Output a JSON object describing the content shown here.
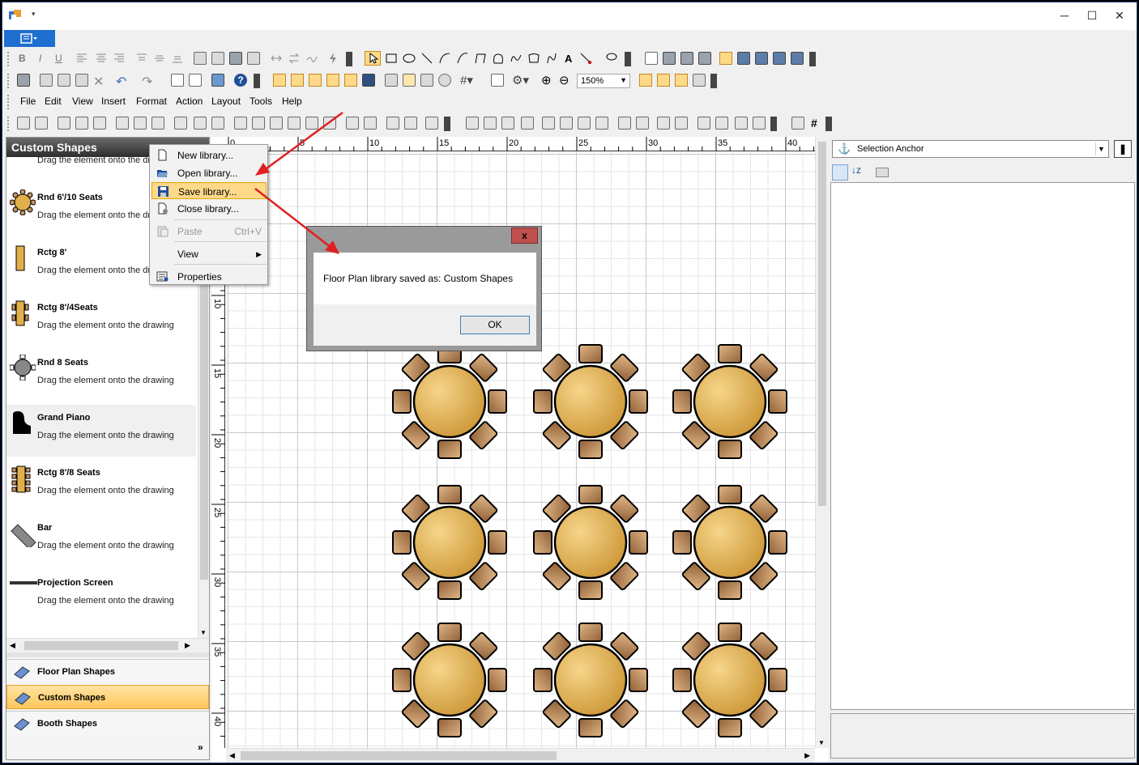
{
  "window": {
    "min": "─",
    "max": "☐",
    "close": "✕"
  },
  "menu": [
    "File",
    "Edit",
    "View",
    "Insert",
    "Format",
    "Action",
    "Layout",
    "Tools",
    "Help"
  ],
  "zoom": "150%",
  "left_panel": {
    "title": "Custom Shapes",
    "items": [
      {
        "name": "",
        "desc": "Drag the element onto the dr"
      },
      {
        "name": "Rnd 6'/10 Seats",
        "desc": "Drag the element onto the dr"
      },
      {
        "name": "Rctg 8'",
        "desc": "Drag the element onto the dr"
      },
      {
        "name": "Rctg 8'/4Seats",
        "desc": "Drag the element onto the drawing"
      },
      {
        "name": "Rnd 8 Seats",
        "desc": "Drag the element onto the drawing"
      },
      {
        "name": "Grand Piano",
        "desc": "Drag the element onto the drawing"
      },
      {
        "name": "Rctg 8'/8 Seats",
        "desc": "Drag the element onto the drawing"
      },
      {
        "name": "Bar",
        "desc": "Drag the element onto the drawing"
      },
      {
        "name": "Projection Screen",
        "desc": "Drag the element onto the drawing"
      }
    ],
    "groups": [
      "Floor Plan Shapes",
      "Custom Shapes",
      "Booth Shapes"
    ],
    "more": "»"
  },
  "ruler": {
    "h": [
      "0",
      "5",
      "10",
      "15",
      "20",
      "25",
      "30",
      "35",
      "40"
    ],
    "v": [
      "10",
      "15",
      "20",
      "25",
      "30",
      "35",
      "40"
    ]
  },
  "context_menu": {
    "items": [
      "New library...",
      "Open library...",
      "Save library...",
      "Close library...",
      "Paste",
      "View",
      "Properties"
    ],
    "paste_shortcut": "Ctrl+V"
  },
  "dialog": {
    "message": "Floor Plan library saved as: Custom Shapes",
    "ok": "OK",
    "close": "x"
  },
  "properties": {
    "object": "Selection Anchor"
  },
  "colors": {
    "accent": "#ffd98a",
    "table": "#e2b04a",
    "chair": "#c39363",
    "arrow": "#e02020"
  }
}
